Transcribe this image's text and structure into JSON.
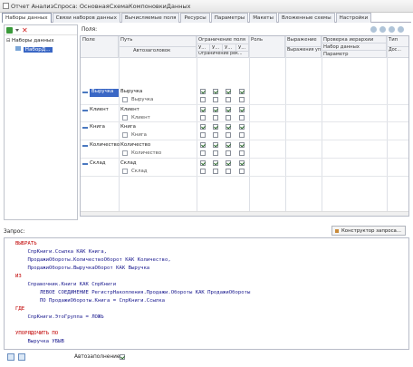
{
  "window": {
    "title": "Отчет АнализСпроса: ОсновнаяСхемаКомпоновкиДанных"
  },
  "tabs": [
    {
      "label": "Наборы данных",
      "active": true
    },
    {
      "label": "Связи наборов данных"
    },
    {
      "label": "Вычисляемые поля"
    },
    {
      "label": "Ресурсы"
    },
    {
      "label": "Параметры"
    },
    {
      "label": "Макеты"
    },
    {
      "label": "Вложенные схемы"
    },
    {
      "label": "Настройки"
    }
  ],
  "left_pane": {
    "root": "Наборы данных",
    "child": "НаборД..."
  },
  "fields_panel": {
    "label": "Поля:",
    "headers": {
      "field": "Поле",
      "path": "Путь",
      "autotitle": "Автозаголовок",
      "field_restriction": "Ограничение поля",
      "attr_restriction": "Ограничение рек...",
      "u1": "У...",
      "u2": "У...",
      "u3": "У...",
      "u4": "У...",
      "role": "Роль",
      "expression": "Выражение",
      "expr_ordering": "Выражения упорядочив...",
      "value_check": "Проверка иерархии",
      "dataset": "Набор данных",
      "parameter": "Параметр",
      "type": "Тип",
      "more": "Дос..."
    },
    "rows": [
      {
        "field": "Выручка",
        "path": "Выручка",
        "sub": "Выручка",
        "checks": [
          true,
          true,
          true,
          true
        ]
      },
      {
        "field": "Клиент",
        "path": "Клиент",
        "sub": "Клиент",
        "checks": [
          true,
          true,
          true,
          true
        ]
      },
      {
        "field": "Книга",
        "path": "Книга",
        "sub": "Книга",
        "checks": [
          true,
          true,
          true,
          true
        ]
      },
      {
        "field": "Количество",
        "path": "Количество",
        "sub": "Количество",
        "checks": [
          true,
          true,
          true,
          true
        ]
      },
      {
        "field": "Склад",
        "path": "Склад",
        "sub": "Склад",
        "checks": [
          true,
          true,
          true,
          true
        ]
      }
    ]
  },
  "query": {
    "label": "Запрос:",
    "builder_button": "Конструктор запроса...",
    "lines": [
      {
        "kw": "ВЫБРАТЬ",
        "txt": ""
      },
      {
        "kw": "",
        "txt": "    СпрКниги.Ссылка КАК Книга,"
      },
      {
        "kw": "",
        "txt": "    ПродажиОбороты.КоличествоОборот КАК Количество,"
      },
      {
        "kw": "",
        "txt": "    ПродажиОбороты.ВыручкаОборот КАК Выручка"
      },
      {
        "kw": "ИЗ",
        "txt": ""
      },
      {
        "kw": "",
        "txt": "    Справочник.Книги КАК СпрКниги"
      },
      {
        "kw": "",
        "txt": "        ЛЕВОЕ СОЕДИНЕНИЕ РегистрНакопления.Продажи.Обороты КАК ПродажиОбороты"
      },
      {
        "kw": "",
        "txt": "        ПО ПродажиОбороты.Книга = СпрКниги.Ссылка"
      },
      {
        "kw": "ГДЕ",
        "txt": ""
      },
      {
        "kw": "",
        "txt": "    СпрКниги.ЭтоГруппа = ЛОЖЬ"
      },
      {
        "kw": "",
        "txt": ""
      },
      {
        "kw": "УПОРЯДОЧИТЬ ПО",
        "txt": ""
      },
      {
        "kw": "",
        "txt": "    Выручка УБЫВ"
      }
    ]
  },
  "bottom": {
    "autofill_label": "Автозаполнение",
    "autofill_checked": true
  }
}
